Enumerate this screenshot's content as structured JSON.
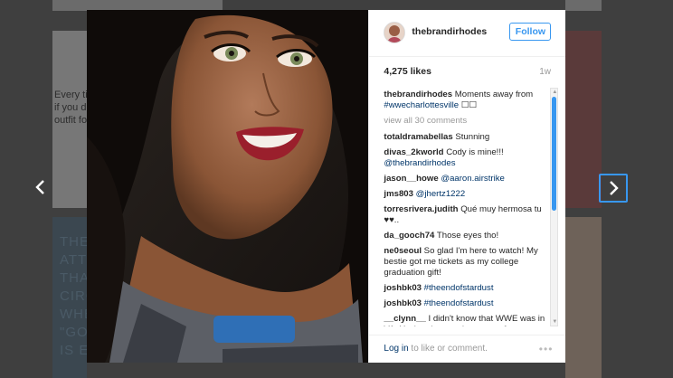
{
  "background": {
    "left_caption_lines": [
      "Every tin",
      "if you die",
      "outfit fo"
    ],
    "tile_text_lines": [
      "THE",
      "ATT",
      "THAN",
      "CIRC",
      "WHE",
      "\"GOO",
      "IS EN"
    ],
    "footer_hint": "Ever"
  },
  "post": {
    "username": "thebrandirhodes",
    "follow_label": "Follow",
    "likes": "4,275 likes",
    "age": "1w",
    "caption_user": "thebrandirhodes",
    "caption_text": "Moments away from",
    "caption_tag": "#wwecharlottesville",
    "caption_suffix": "☐☐",
    "view_all": "view all 30 comments",
    "comments": [
      {
        "user": "totaldramabellas",
        "text": "Stunning",
        "link": ""
      },
      {
        "user": "divas_2kworld",
        "text": "Cody is mine!!!",
        "link": "@thebrandirhodes"
      },
      {
        "user": "jason__howe",
        "text": "",
        "link": "@aaron.airstrike"
      },
      {
        "user": "jms803",
        "text": "",
        "link": "@jhertz1222"
      },
      {
        "user": "torresrivera.judith",
        "text": "Qué muy hermosa tu ♥♥..",
        "link": ""
      },
      {
        "user": "da_gooch74",
        "text": "Those eyes tho!",
        "link": ""
      },
      {
        "user": "ne0seoul",
        "text": "So glad I'm here to watch! My bestie got me tickets as my college graduation gift!",
        "link": ""
      },
      {
        "user": "joshbk03",
        "text": "",
        "link": "#theendofstardust"
      },
      {
        "user": "joshbk03",
        "text": "",
        "link": "#theendofstardust"
      },
      {
        "user": "__clynn__",
        "text": "I didn't know that WWE was in VA. You're about an hour or so from me.",
        "link": ""
      }
    ],
    "login_link": "Log in",
    "login_text": " to like or comment.",
    "more": "•••"
  },
  "colors": {
    "accent": "#3897f0",
    "link": "#003569",
    "muted": "#999999"
  },
  "icons": {
    "prev": "chevron-left-icon",
    "next": "chevron-right-icon"
  }
}
